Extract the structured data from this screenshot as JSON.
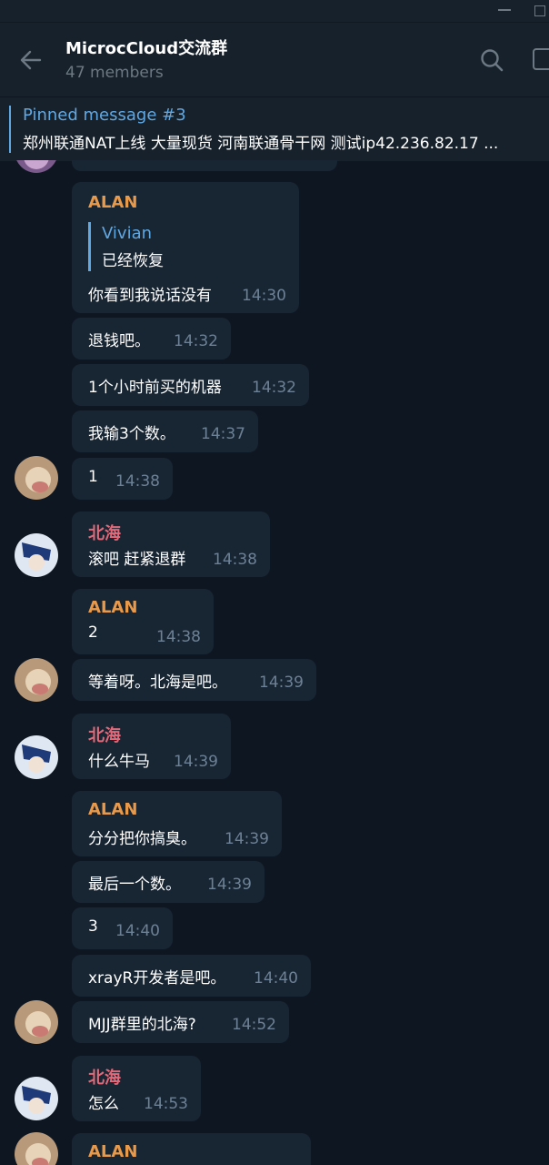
{
  "header": {
    "title": "MicrocCloud交流群",
    "subtitle": "47 members"
  },
  "pinned": {
    "title": "Pinned message #3",
    "text": "郑州联通NAT上线 大量现货 河南联通骨干网 测试ip42.236.82.17  ..."
  },
  "messages": [
    {
      "sender": "ALAN",
      "quote_name": "Vivian",
      "quote_text": "已经恢复",
      "text": "你看到我说话没有",
      "time": "14:30"
    },
    {
      "text": "退钱吧。",
      "time": "14:32"
    },
    {
      "text": "1个小时前买的机器",
      "time": "14:32"
    },
    {
      "text": "我输3个数。",
      "time": "14:37"
    },
    {
      "text": "1",
      "time": "14:38"
    },
    {
      "sender": "北海",
      "text": "滚吧 赶紧退群",
      "time": "14:38"
    },
    {
      "sender": "ALAN",
      "text": "2",
      "time": "14:38"
    },
    {
      "text": "等着呀。北海是吧。",
      "time": "14:39"
    },
    {
      "sender": "北海",
      "text": "什么牛马",
      "time": "14:39"
    },
    {
      "sender": "ALAN",
      "text": "分分把你搞臭。",
      "time": "14:39"
    },
    {
      "text": "最后一个数。",
      "time": "14:39"
    },
    {
      "text": "3",
      "time": "14:40"
    },
    {
      "text": "xrayR开发者是吧。",
      "time": "14:40"
    },
    {
      "text": "MJJ群里的北海?",
      "time": "14:52"
    },
    {
      "sender": "北海",
      "text": "怎么",
      "time": "14:53"
    },
    {
      "sender": "ALAN"
    }
  ],
  "colors": {
    "background": "#0e1621",
    "bubble": "#182533",
    "accent": "#5fa8e3",
    "alan": "#e89a4a",
    "beihai": "#e06a7a"
  },
  "icons": {
    "back": "arrow-left",
    "search": "magnifier",
    "more": "square"
  }
}
